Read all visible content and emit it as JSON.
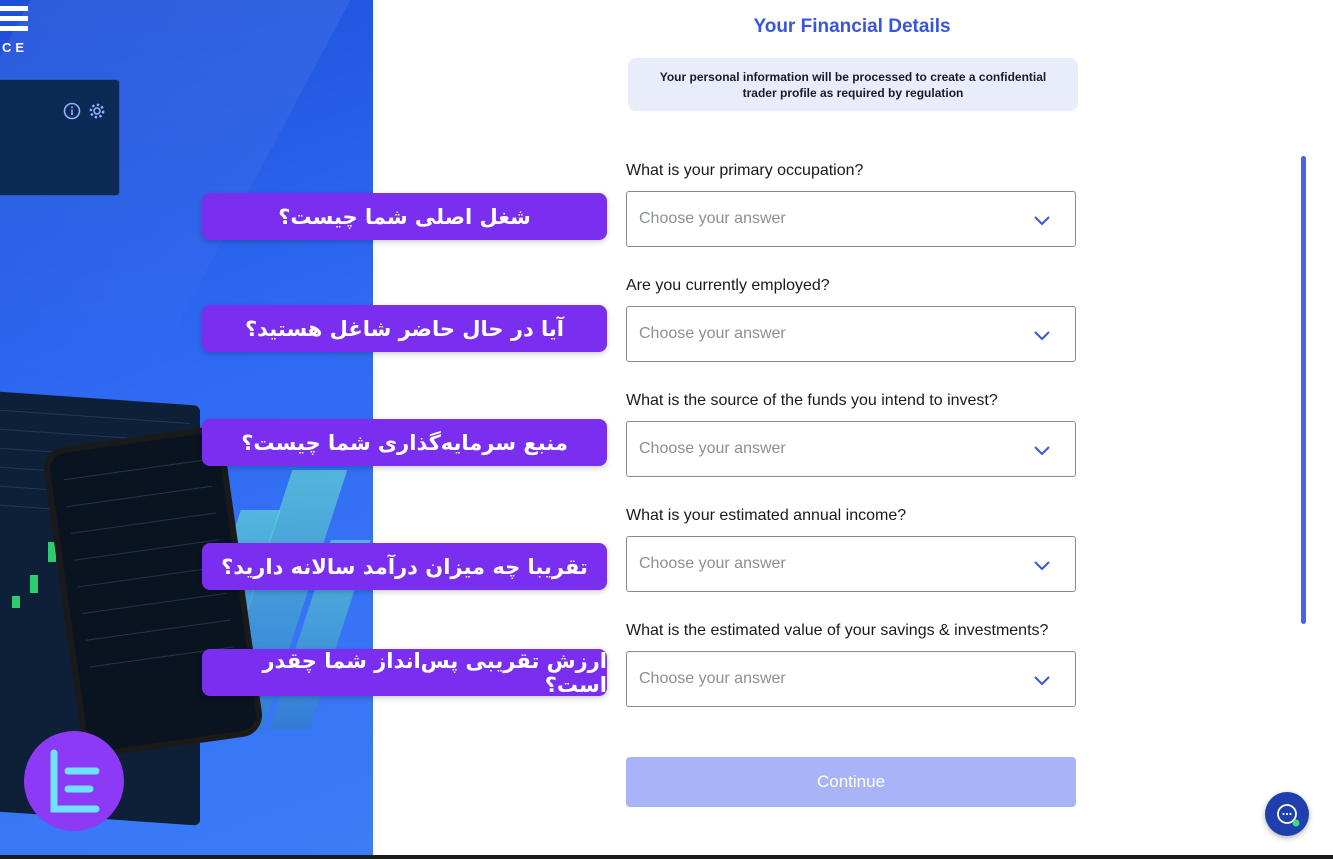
{
  "brand": {
    "tail": "CE"
  },
  "form": {
    "title": "Your Financial Details",
    "notice": "Your personal information will be processed to create a confidential trader profile as required by regulation",
    "questions": [
      {
        "label": "What is your primary occupation?",
        "placeholder": "Choose your answer"
      },
      {
        "label": "Are you currently employed?",
        "placeholder": "Choose your answer"
      },
      {
        "label": "What is the source of the funds you intend to invest?",
        "placeholder": "Choose your answer"
      },
      {
        "label": "What is your estimated annual income?",
        "placeholder": "Choose your answer"
      },
      {
        "label": "What is the estimated value of your savings & investments?",
        "placeholder": "Choose your answer"
      }
    ],
    "continue_label": "Continue"
  },
  "annotations": [
    "شغل اصلی شما چیست؟",
    "آیا در حال حاضر شاغل هستید؟",
    "منبع سرمایه‌گذاری شما چیست؟",
    "تقریبا چه میزان درآمد سالانه دارید؟",
    "ارزش تقریبی پس‌انداز شما چقدر است؟"
  ],
  "icons": {
    "info": "info-icon",
    "settings": "gear-icon",
    "chevron": "chevron-down-icon",
    "chat": "chat-icon"
  },
  "colors": {
    "accent": "#3a55dc",
    "pill": "#7a2ff0",
    "continue_disabled": "#a9b4f8",
    "panel_blue": "#2f6af3"
  }
}
